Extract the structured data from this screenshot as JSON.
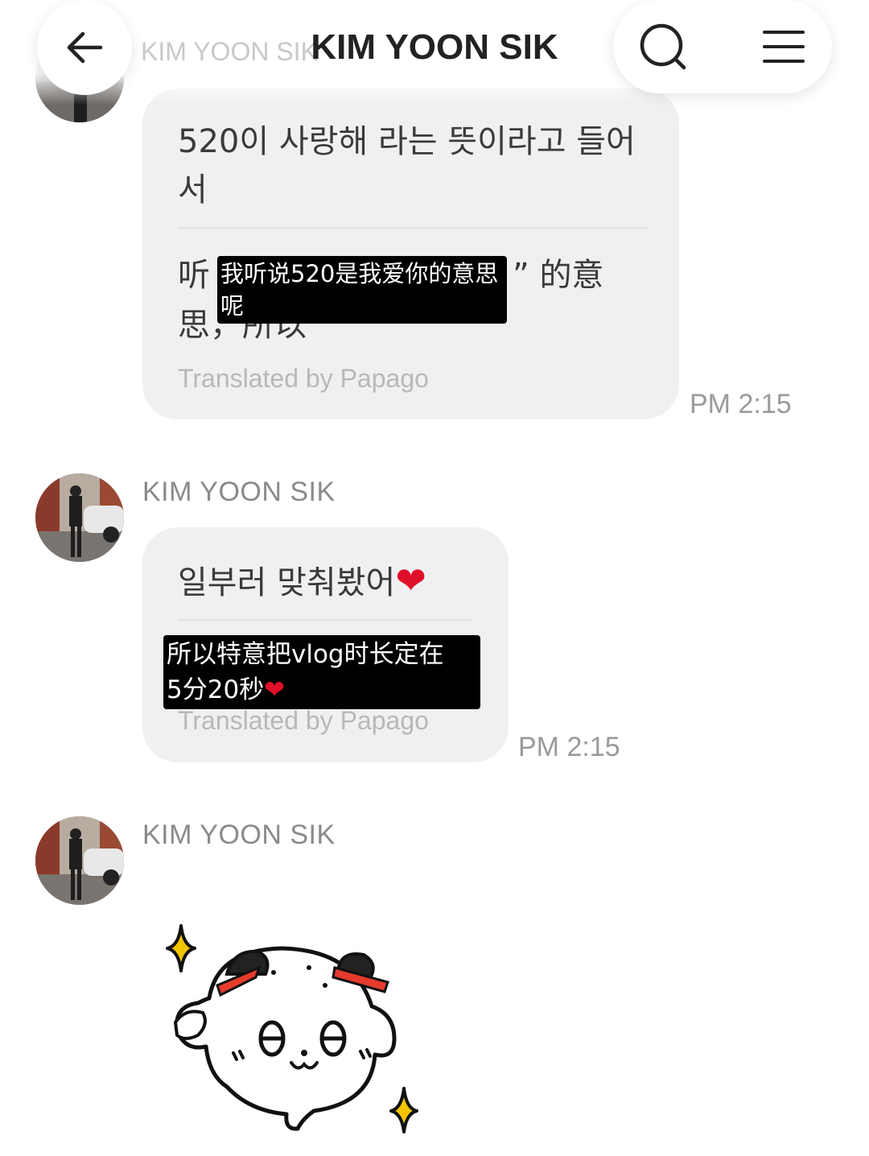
{
  "header": {
    "title": "KIM YOON SIK",
    "ghost_title": "KIM YOON SIK",
    "back_icon": "arrow-left-icon",
    "search_icon": "search-icon",
    "menu_icon": "hamburger-menu-icon"
  },
  "messages": [
    {
      "original": "520이 사랑해 라는 뜻이라고 들어서",
      "original_line1": "520이 사랑해 라는 뜻이라고 들어",
      "original_line2": "서",
      "translation_visible_left1": "听",
      "translation_visible_right1": "” 的意",
      "translation_visible_left2": "思，所以",
      "translated_by": "Translated by Papago",
      "time": "PM 2:15",
      "annotation": "我听说520是我爱你的意思呢"
    },
    {
      "sender": "KIM YOON SIK",
      "original": "일부러 맞춰봤어",
      "heart": "❤",
      "translated_by": "Translated by Papago",
      "time": "PM 2:15",
      "annotation_line1": "所以特意把vlog时长定在",
      "annotation_line2": "5分20秒",
      "annotation_heart": "❤"
    },
    {
      "sender": "KIM YOON SIK",
      "sticker": "round-bun-character-sticker"
    }
  ],
  "colors": {
    "bubble": "#f0f0f2",
    "heart": "#e0102a",
    "sparkle": "#f2c400",
    "bow": "#e53b2c"
  }
}
